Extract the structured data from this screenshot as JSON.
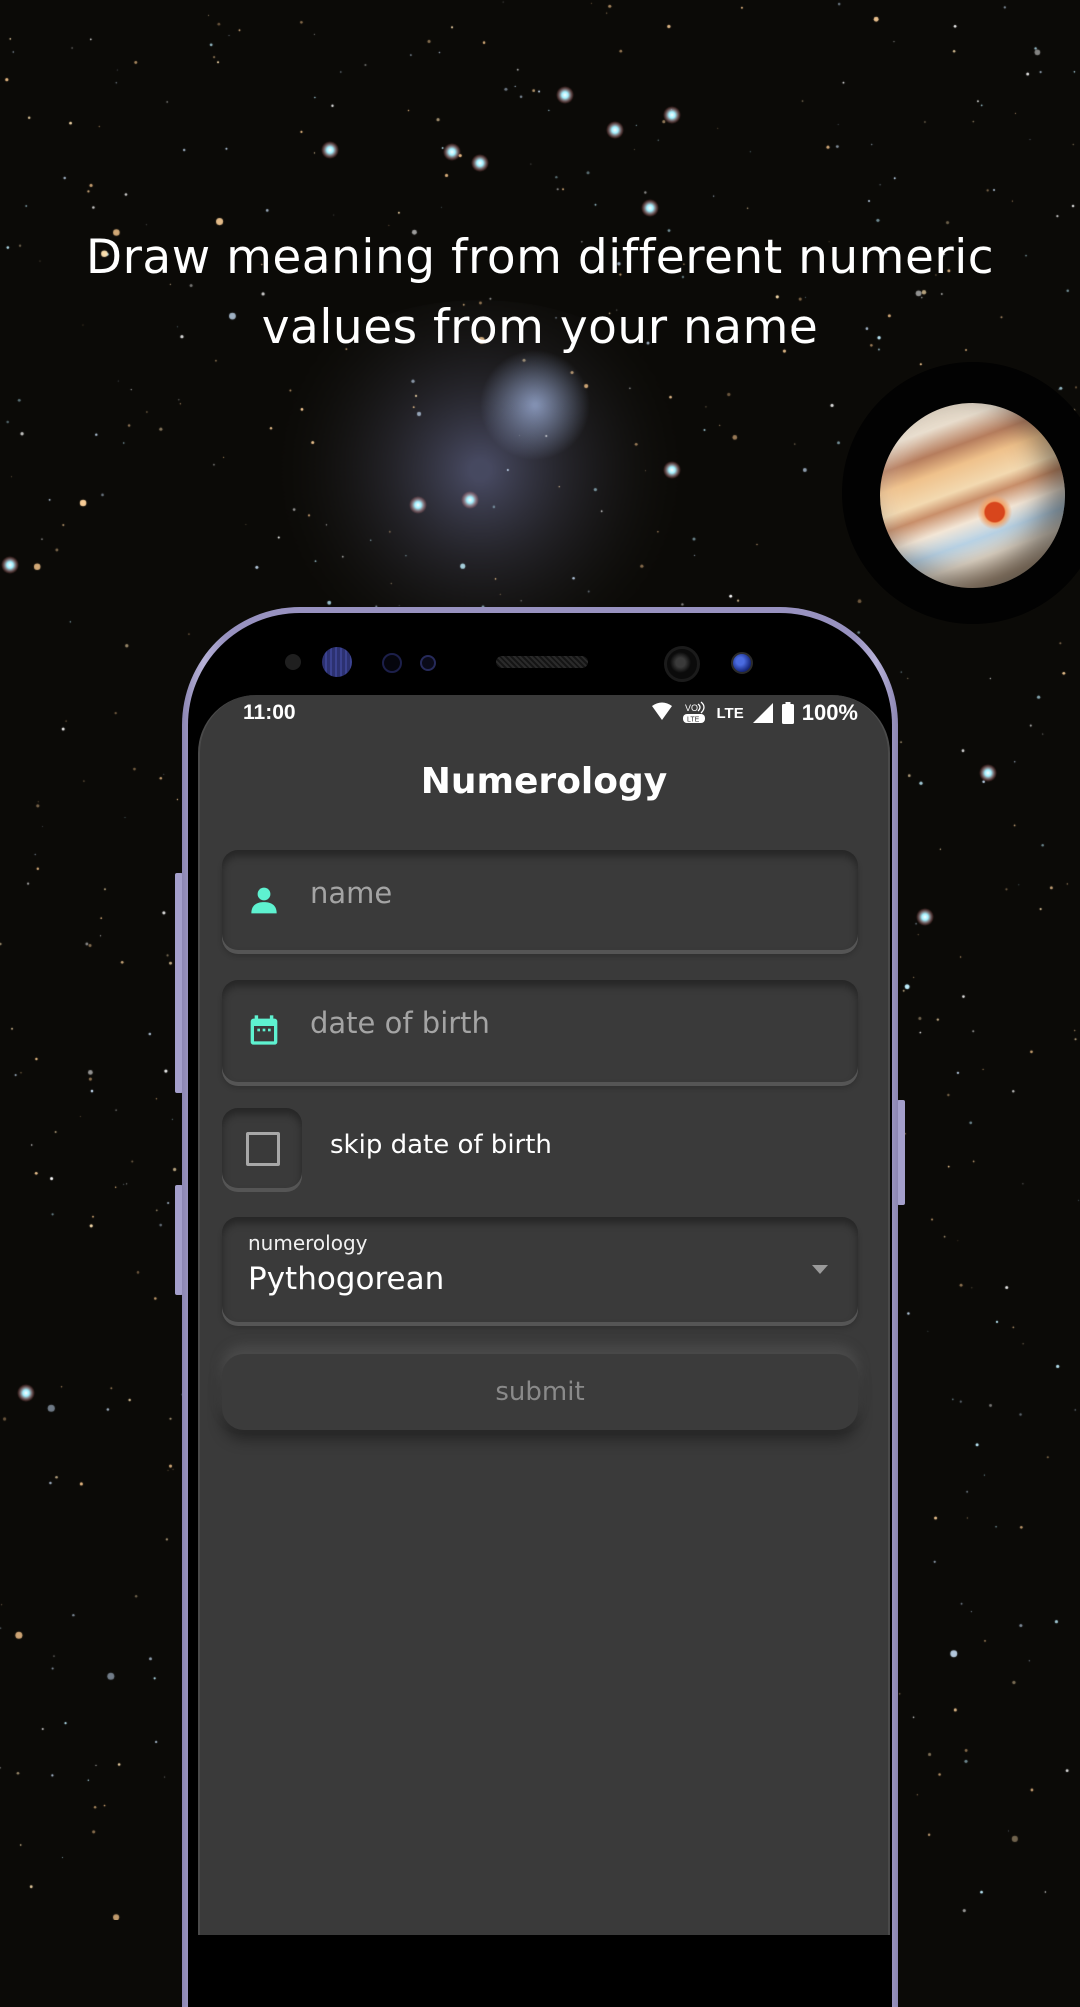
{
  "promo": {
    "headline_line1": "Draw meaning from different numeric",
    "headline_line2": "values from your name"
  },
  "status_bar": {
    "time": "11:00",
    "icons": [
      "wifi-icon",
      "volte-icon",
      "lte-icon",
      "signal-icon",
      "battery-icon"
    ],
    "lte_label": "LTE",
    "battery_percent": "100%"
  },
  "app": {
    "title": "Numerology",
    "accent_color": "#5ef2d0",
    "name_field": {
      "icon": "person-icon",
      "placeholder": "name",
      "value": ""
    },
    "dob_field": {
      "icon": "calendar-icon",
      "placeholder": "date of birth",
      "value": ""
    },
    "skip_dob": {
      "label": "skip date of birth",
      "checked": false
    },
    "numerology_select": {
      "label": "numerology",
      "selected": "Pythogorean"
    },
    "submit_label": "submit"
  }
}
